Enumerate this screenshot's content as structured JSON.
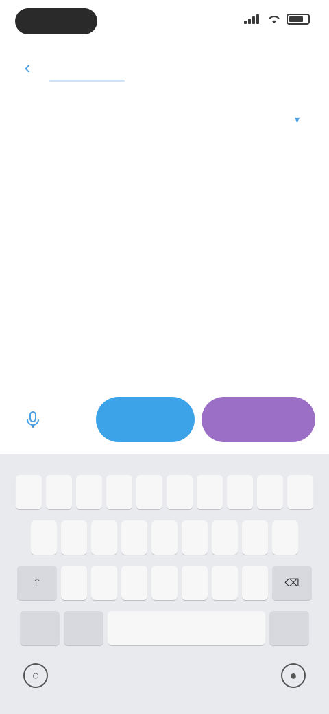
{
  "status_bar": {
    "icons": [
      "signal-icon",
      "wifi-icon",
      "battery-icon"
    ]
  },
  "nav": {
    "back_icon": "chevron-left-icon",
    "title": ""
  },
  "body": {
    "paragraphs": [
      "",
      ""
    ]
  },
  "actions": {
    "mic_icon": "microphone-icon",
    "blue_button_label": "",
    "purple_button_label": ""
  },
  "keyboard": {
    "rows": [
      [
        "",
        "",
        "",
        "",
        "",
        "",
        "",
        "",
        "",
        ""
      ],
      [
        "",
        "",
        "",
        "",
        "",
        "",
        "",
        "",
        ""
      ],
      [
        "",
        "",
        "",
        "",
        "",
        "",
        "",
        ""
      ]
    ],
    "bottom_left_1": "",
    "bottom_left_2": "",
    "space_label": "",
    "return_label": "",
    "globe_icon": "globe-icon",
    "dictation_icon": "microphone-icon"
  },
  "colors": {
    "accent_blue": "#3da3e8",
    "accent_purple": "#9b6fc6",
    "link_blue": "#4aa0e6",
    "keyboard_bg": "#e9eaed"
  }
}
